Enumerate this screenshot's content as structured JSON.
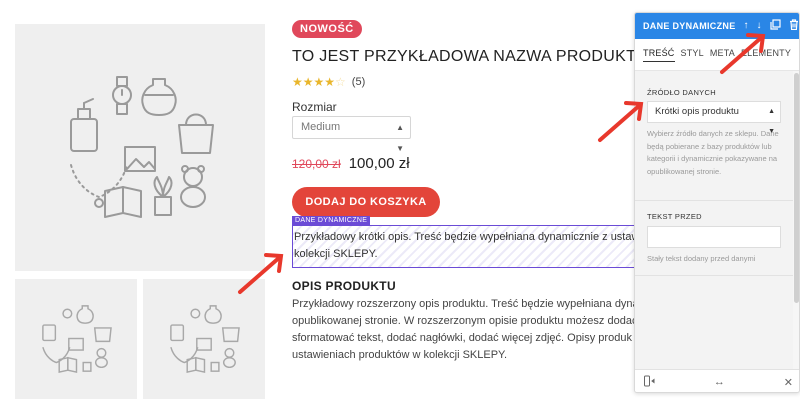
{
  "product": {
    "badge": "NOWOŚĆ",
    "title": "TO JEST PRZYKŁADOWA NAZWA PRODUKTU",
    "rating_stars_filled": 4,
    "rating_stars_total": 5,
    "rating_count": "(5)",
    "size_label": "Rozmiar",
    "size_value": "Medium",
    "price_old": "120,00 zł",
    "price_new": "100,00 zł",
    "add_to_cart": "DODAJ DO KOSZYKA",
    "dynamic_tag": "DANE DYNAMICZNE",
    "short_description": "Przykładowy krótki opis. Treść będzie wypełniana dynamicznie z ustaw kolekcji SKLEPY.",
    "description_heading": "OPIS PRODUKTU",
    "description_text": "Przykładowy rozszerzony opis produktu. Treść będzie wypełniana dyna opublikowanej stronie. W rozszerzonym opisie produktu możesz dodać sformatować tekst, dodać nagłówki, dodać więcej zdjęć. Opisy produk ustawieniach produktów w kolekcji SKLEPY."
  },
  "panel": {
    "title": "DANE DYNAMICZNE",
    "tabs": [
      "TREŚĆ",
      "STYL",
      "META",
      "ELEMENTY"
    ],
    "source_label": "ŹRÓDŁO DANYCH",
    "source_value": "Krótki opis produktu",
    "source_help": "Wybierz źródło danych ze sklepu. Dane będą pobierane z bazy produktów lub kategorii i dynamicznie pokazywane na opublikowanej stronie.",
    "text_before_label": "TEKST PRZED",
    "text_before_value": "",
    "text_before_help": "Stały tekst dodany przed danymi"
  },
  "colors": {
    "accent_blue": "#2a86e6",
    "badge_red": "#e0485b",
    "button_red": "#e3453a",
    "dynamic_purple": "#6b4bd6",
    "arrow_red": "#e8382c"
  }
}
